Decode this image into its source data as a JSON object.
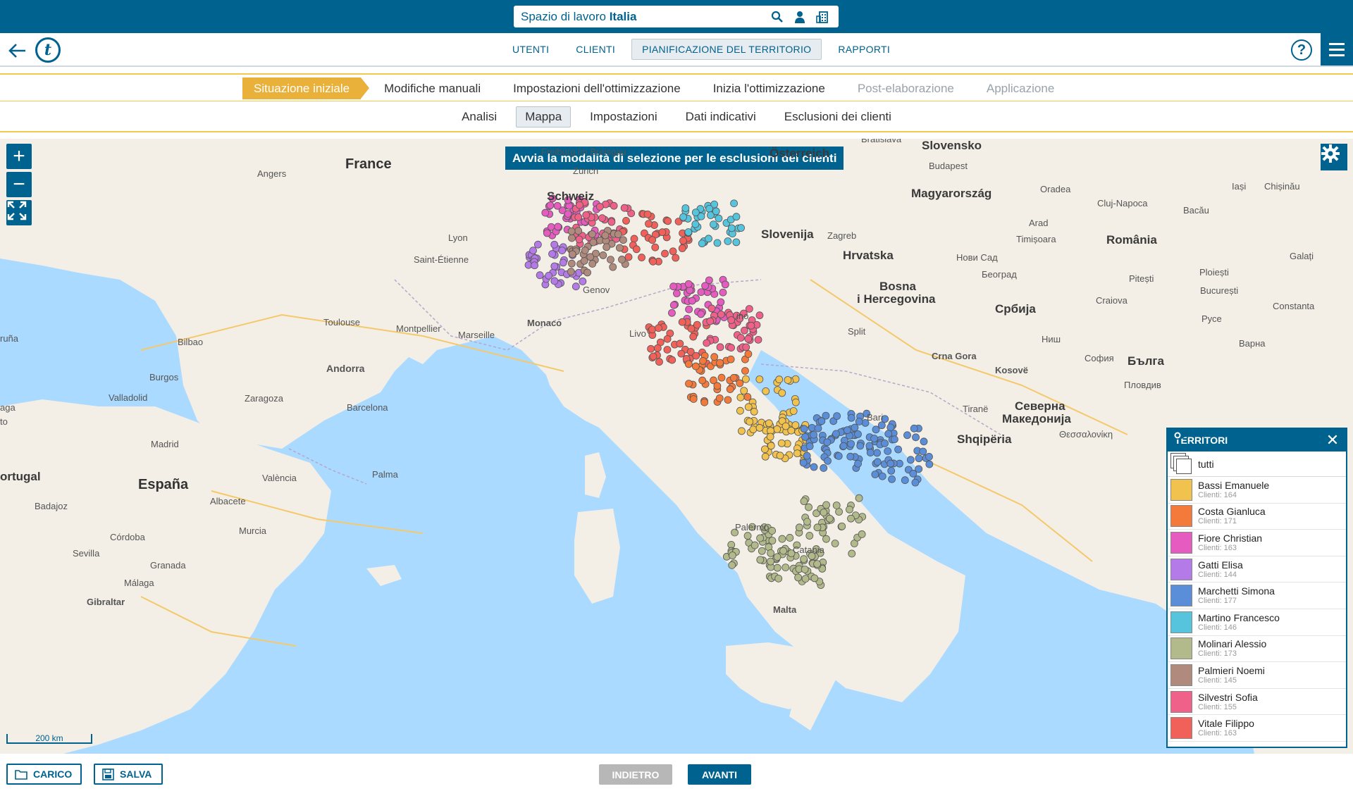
{
  "workspace": {
    "prefix": "Spazio di lavoro ",
    "name": "Italia"
  },
  "nav": {
    "tabs": [
      "UTENTI",
      "CLIENTI",
      "PIANIFICAZIONE DEL TERRITORIO",
      "RAPPORTI"
    ],
    "active": "PIANIFICAZIONE DEL TERRITORIO"
  },
  "help_label": "?",
  "steps": [
    {
      "label": "Situazione iniziale",
      "state": "active"
    },
    {
      "label": "Modifiche manuali",
      "state": "normal"
    },
    {
      "label": "Impostazioni dell'ottimizzazione",
      "state": "normal"
    },
    {
      "label": "Inizia l'ottimizzazione",
      "state": "normal"
    },
    {
      "label": "Post-elaborazione",
      "state": "disabled"
    },
    {
      "label": "Applicazione",
      "state": "disabled"
    }
  ],
  "subtabs": [
    "Analisi",
    "Mappa",
    "Impostazioni",
    "Dati indicativi",
    "Esclusioni dei clienti"
  ],
  "subtab_active": "Mappa",
  "map": {
    "selection_banner": "Avvia la modalità di selezione per le esclusioni dei clienti",
    "scale_label": "200 km",
    "places": {
      "france": "France",
      "schweiz": "Schweiz",
      "osterreich": "Österreich",
      "slovensko": "Slovensko",
      "magyarorszag": "Magyarország",
      "romania": "România",
      "slovenija": "Slovenija",
      "hrvatska": "Hrvatska",
      "bosna": "Bosna",
      "hercegovina": "i Hercegovina",
      "srbija": "Србија",
      "crna_gora": "Crna Gora",
      "kosovo": "Kosovë",
      "shqiperia": "Shqipëria",
      "makedonija1": "Северна",
      "makedonija2": "Македонија",
      "balgariya": "Бълга",
      "espana": "España",
      "andorra": "Andorra",
      "portugal": "ortugal",
      "angers": "Angers",
      "lyon": "Lyon",
      "saint_etienne": "Saint-Étienne",
      "toulouse": "Toulouse",
      "montpellier": "Montpellier",
      "marseille": "Marseille",
      "monaco": "Monaco",
      "bilbao": "Bilbao",
      "burgos": "Burgos",
      "valladolid": "Valladolid",
      "zaragoza": "Zaragoza",
      "barcelona": "Barcelona",
      "madrid": "Madrid",
      "valencia": "València",
      "palma": "Palma",
      "albacete": "Albacete",
      "badajoz": "Badajoz",
      "cordoba": "Córdoba",
      "murcia": "Murcia",
      "sevilla": "Sevilla",
      "granada": "Granada",
      "malaga": "Málaga",
      "gibraltar": "Gibraltar",
      "malta": "Malta",
      "freiburg": "Freiburg im Breisgau",
      "zurich": "Zürich",
      "bratislava": "Bratislava",
      "budapest": "Budapest",
      "oradea": "Oradea",
      "cluj": "Cluj-Napoca",
      "iasi": "Iași",
      "chisinau": "Chișinău",
      "bacau": "Bacău",
      "arad": "Arad",
      "timisoara": "Timișoara",
      "zagreb": "Zagreb",
      "novi_sad": "Нови Сад",
      "beograd": "Београд",
      "ploiesti": "Ploiești",
      "galati": "Galați",
      "pitesti": "Pitești",
      "bucuresti": "București",
      "craiova": "Craiova",
      "constanta": "Constanta",
      "pyce": "Русе",
      "varna": "Варна",
      "nish": "Ниш",
      "sofia": "София",
      "plovdiv": "Пловдив",
      "split": "Split",
      "tirane": "Tiranë",
      "thessaloniki": "Θεσσαλονίκη",
      "livorno": "Livo",
      "ancona": "ino",
      "bari": "Bari",
      "genova": "Genov",
      "palermo": "Palermo",
      "catania": "Catania",
      "ruña": "ruña",
      "aga": "aga",
      "to": "to"
    }
  },
  "territories": {
    "title": "TERRITORI",
    "all_label": "tutti",
    "items": [
      {
        "name": "Bassi Emanuele",
        "count": "Clienti: 164",
        "color": "#f2c24e"
      },
      {
        "name": "Costa Gianluca",
        "count": "Clienti: 171",
        "color": "#f47a3c"
      },
      {
        "name": "Fiore Christian",
        "count": "Clienti: 163",
        "color": "#e55bbf"
      },
      {
        "name": "Gatti Elisa",
        "count": "Clienti: 144",
        "color": "#b47ae8"
      },
      {
        "name": "Marchetti Simona",
        "count": "Clienti: 177",
        "color": "#5b8ed8"
      },
      {
        "name": "Martino Francesco",
        "count": "Clienti: 146",
        "color": "#56c4dc"
      },
      {
        "name": "Molinari Alessio",
        "count": "Clienti: 173",
        "color": "#b2b98a"
      },
      {
        "name": "Palmieri Noemi",
        "count": "Clienti: 145",
        "color": "#b08a7c"
      },
      {
        "name": "Silvestri Sofia",
        "count": "Clienti: 155",
        "color": "#ef6189"
      },
      {
        "name": "Vitale Filippo",
        "count": "Clienti: 163",
        "color": "#f2605a"
      }
    ]
  },
  "bottom": {
    "load_label": "CARICO",
    "save_label": "SALVA",
    "back_label": "INDIETRO",
    "next_label": "AVANTI"
  },
  "colors": {
    "brand": "#00628f",
    "step_active": "#e9b03a",
    "disabled": "#b7b7b7"
  }
}
